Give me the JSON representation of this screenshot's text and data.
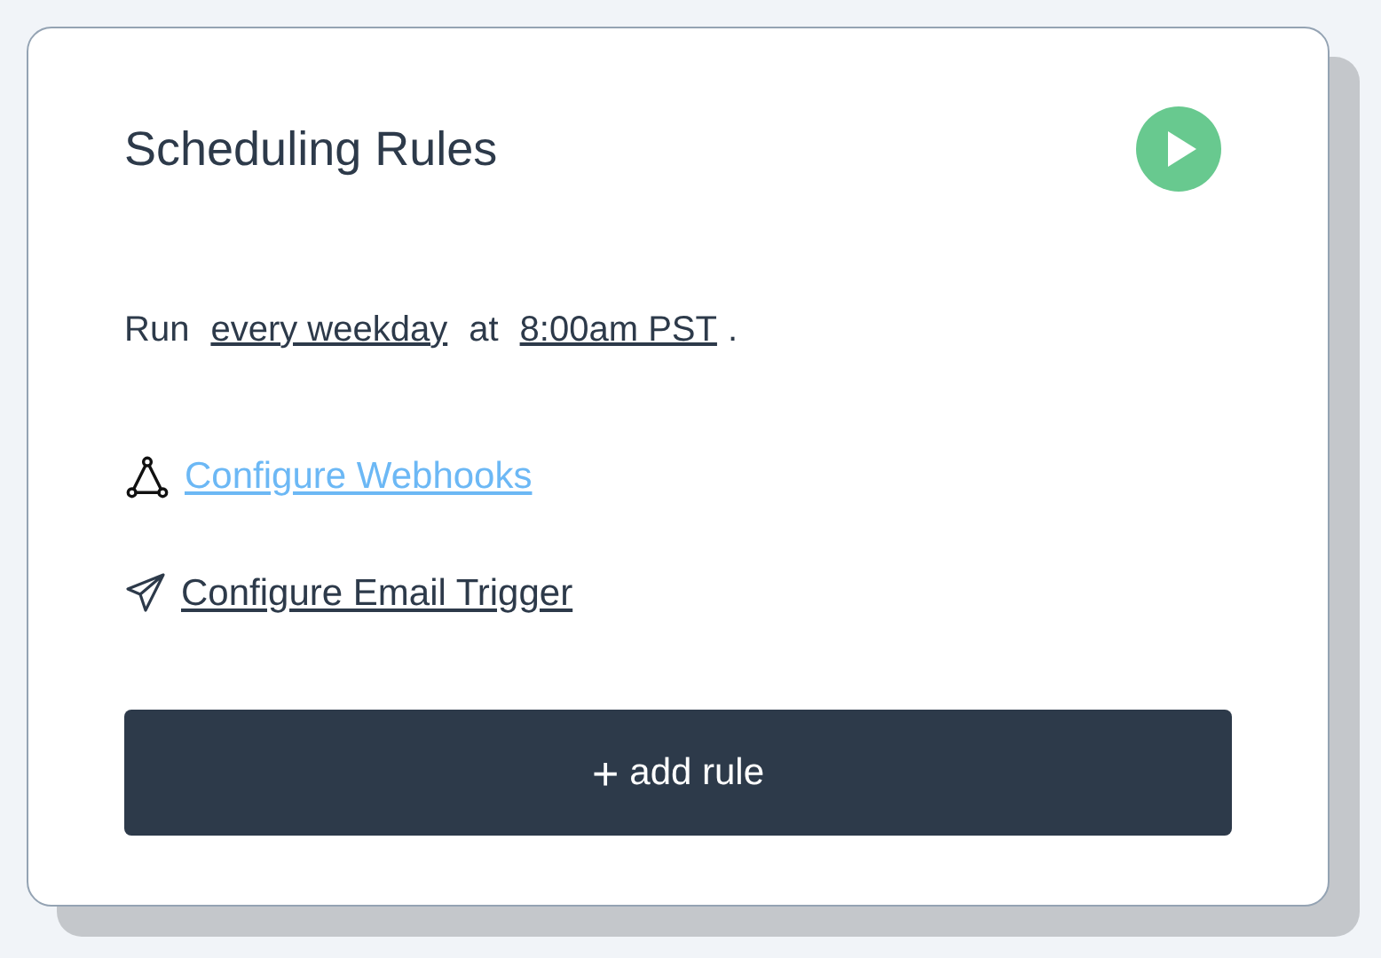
{
  "card": {
    "title": "Scheduling Rules",
    "schedule": {
      "prefix": "Run",
      "frequency": "every weekday",
      "joiner": "at",
      "time": "8:00am PST",
      "suffix": "."
    },
    "links": [
      {
        "kind": "webhook",
        "label": "Configure Webhooks",
        "color": "#6cb8f5"
      },
      {
        "kind": "email",
        "label": "Configure Email Trigger",
        "color": "#2d3a4a"
      }
    ],
    "button": {
      "icon": "+",
      "label": "add rule"
    }
  }
}
